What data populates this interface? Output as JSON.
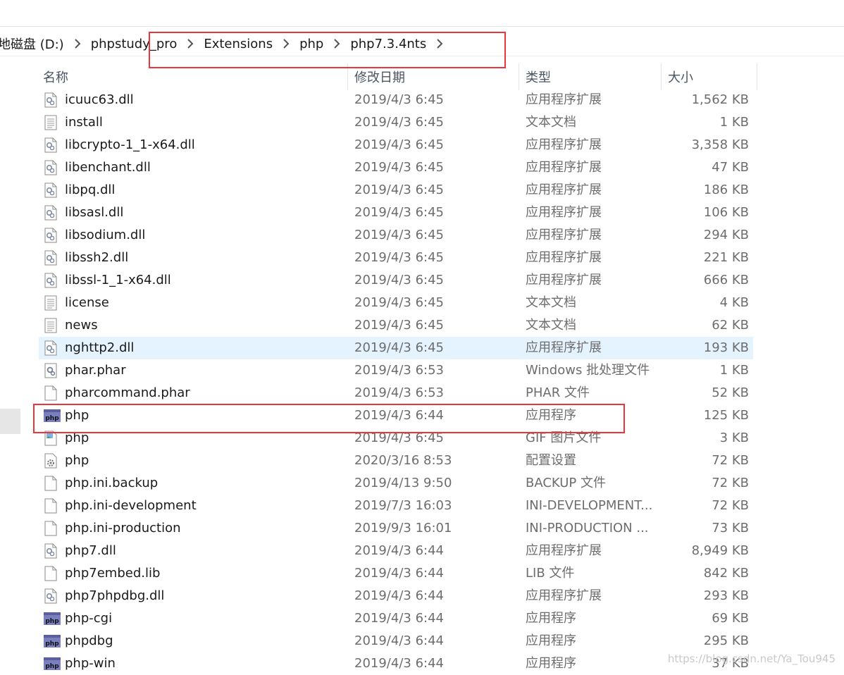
{
  "breadcrumb": {
    "items": [
      {
        "label": "地磁盘 (D:)"
      },
      {
        "label": "phpstudy_pro"
      },
      {
        "label": "Extensions"
      },
      {
        "label": "php"
      },
      {
        "label": "php7.3.4nts"
      }
    ]
  },
  "columns": {
    "name": "名称",
    "date": "修改日期",
    "type": "类型",
    "size": "大小"
  },
  "files": [
    {
      "name": "icuuc63.dll",
      "date": "2019/4/3 6:45",
      "type": "应用程序扩展",
      "size": "1,562 KB",
      "icon": "dll-icon"
    },
    {
      "name": "install",
      "date": "2019/4/3 6:45",
      "type": "文本文档",
      "size": "1 KB",
      "icon": "text-file-icon"
    },
    {
      "name": "libcrypto-1_1-x64.dll",
      "date": "2019/4/3 6:45",
      "type": "应用程序扩展",
      "size": "3,358 KB",
      "icon": "dll-icon"
    },
    {
      "name": "libenchant.dll",
      "date": "2019/4/3 6:45",
      "type": "应用程序扩展",
      "size": "47 KB",
      "icon": "dll-icon"
    },
    {
      "name": "libpq.dll",
      "date": "2019/4/3 6:45",
      "type": "应用程序扩展",
      "size": "186 KB",
      "icon": "dll-icon"
    },
    {
      "name": "libsasl.dll",
      "date": "2019/4/3 6:45",
      "type": "应用程序扩展",
      "size": "106 KB",
      "icon": "dll-icon"
    },
    {
      "name": "libsodium.dll",
      "date": "2019/4/3 6:45",
      "type": "应用程序扩展",
      "size": "294 KB",
      "icon": "dll-icon"
    },
    {
      "name": "libssh2.dll",
      "date": "2019/4/3 6:45",
      "type": "应用程序扩展",
      "size": "221 KB",
      "icon": "dll-icon"
    },
    {
      "name": "libssl-1_1-x64.dll",
      "date": "2019/4/3 6:45",
      "type": "应用程序扩展",
      "size": "666 KB",
      "icon": "dll-icon"
    },
    {
      "name": "license",
      "date": "2019/4/3 6:45",
      "type": "文本文档",
      "size": "4 KB",
      "icon": "text-file-icon"
    },
    {
      "name": "news",
      "date": "2019/4/3 6:45",
      "type": "文本文档",
      "size": "62 KB",
      "icon": "text-file-icon"
    },
    {
      "name": "nghttp2.dll",
      "date": "2019/4/3 6:45",
      "type": "应用程序扩展",
      "size": "193 KB",
      "icon": "dll-icon",
      "selected": true
    },
    {
      "name": "phar.phar",
      "date": "2019/4/3 6:53",
      "type": "Windows 批处理文件",
      "size": "1 KB",
      "icon": "batch-file-icon"
    },
    {
      "name": "pharcommand.phar",
      "date": "2019/4/3 6:53",
      "type": "PHAR 文件",
      "size": "52 KB",
      "icon": "blank-file-icon"
    },
    {
      "name": "php",
      "date": "2019/4/3 6:44",
      "type": "应用程序",
      "size": "125 KB",
      "icon": "php-exe-icon"
    },
    {
      "name": "php",
      "date": "2019/4/3 6:45",
      "type": "GIF 图片文件",
      "size": "3 KB",
      "icon": "gif-image-icon"
    },
    {
      "name": "php",
      "date": "2020/3/16 8:53",
      "type": "配置设置",
      "size": "72 KB",
      "icon": "config-file-icon"
    },
    {
      "name": "php.ini.backup",
      "date": "2019/4/13 9:50",
      "type": "BACKUP 文件",
      "size": "72 KB",
      "icon": "blank-file-icon"
    },
    {
      "name": "php.ini-development",
      "date": "2019/7/3 16:03",
      "type": "INI-DEVELOPMENT...",
      "size": "72 KB",
      "icon": "blank-file-icon"
    },
    {
      "name": "php.ini-production",
      "date": "2019/9/3 16:01",
      "type": "INI-PRODUCTION ...",
      "size": "73 KB",
      "icon": "blank-file-icon"
    },
    {
      "name": "php7.dll",
      "date": "2019/4/3 6:44",
      "type": "应用程序扩展",
      "size": "8,949 KB",
      "icon": "dll-icon"
    },
    {
      "name": "php7embed.lib",
      "date": "2019/4/3 6:44",
      "type": "LIB 文件",
      "size": "842 KB",
      "icon": "blank-file-icon"
    },
    {
      "name": "php7phpdbg.dll",
      "date": "2019/4/3 6:44",
      "type": "应用程序扩展",
      "size": "293 KB",
      "icon": "dll-icon"
    },
    {
      "name": "php-cgi",
      "date": "2019/4/3 6:44",
      "type": "应用程序",
      "size": "69 KB",
      "icon": "php-exe-icon"
    },
    {
      "name": "phpdbg",
      "date": "2019/4/3 6:44",
      "type": "应用程序",
      "size": "295 KB",
      "icon": "php-exe-icon"
    },
    {
      "name": "php-win",
      "date": "2019/4/3 6:44",
      "type": "应用程序",
      "size": "37 KB",
      "icon": "php-exe-icon"
    }
  ],
  "watermark": "https://blog.csdn.net/Ya_Tou945",
  "colors": {
    "highlight_box": "#e8363c",
    "selected_row": "#e5f3ff"
  }
}
